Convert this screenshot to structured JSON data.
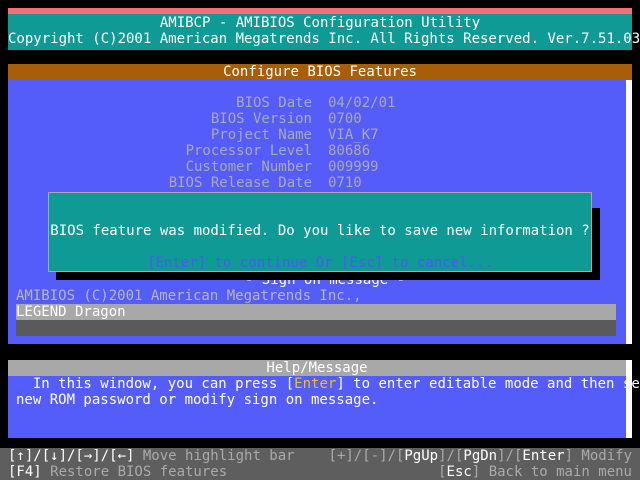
{
  "title_bar": {
    "line1": "AMIBCP - AMIBIOS Configuration Utility",
    "line2": "Copyright (C)2001 American Megatrends Inc. All Rights Reserved. Ver.7.51.03"
  },
  "config": {
    "header": "Configure BIOS Features",
    "fields": [
      {
        "label": "BIOS Date",
        "value": "04/02/01"
      },
      {
        "label": "BIOS Version",
        "value": "0700"
      },
      {
        "label": "Project Name",
        "value": "VIA_K7"
      },
      {
        "label": "Processor Level",
        "value": "80686"
      },
      {
        "label": "Customer Number",
        "value": "009999"
      },
      {
        "label": "BIOS Release Date",
        "value": "0710"
      }
    ],
    "sign_on_header": "- Sign on message -",
    "sign_on_line1": "AMIBIOS (C)2001 American Megatrends Inc.,",
    "sign_on_line2": "LEGEND Dragon",
    "sign_on_line3": ""
  },
  "dialog": {
    "message": "BIOS feature was modified. Do you like to save new information ?",
    "hint": "[Enter] to continue Or [Esc] to cancel..."
  },
  "help": {
    "header": "Help/Message",
    "line1_pre": "  In this window, you can press [",
    "line1_key": "Enter",
    "line1_post": "] to enter editable mode and then set",
    "line2": "new ROM password or modify sign on message."
  },
  "bottom_bar": {
    "left_row1_keys": "[↑]/[↓]/[→]/[←]",
    "left_row1_text": " Move highlight bar",
    "left_row2_key": "[F4]",
    "left_row2_text": " Restore BIOS features",
    "right_row1_p1": "[+]/[-]/[",
    "right_row1_k1": "PgUp",
    "right_row1_p2": "]/[",
    "right_row1_k2": "PgDn",
    "right_row1_p3": "]/[",
    "right_row1_k3": "Enter",
    "right_row1_p4": "] Modify",
    "right_row2_p1": "[",
    "right_row2_k1": "Esc",
    "right_row2_p2": "] Back to main menu"
  },
  "colors": {
    "title_bg": "#0f9a96",
    "panel_bg": "#545cfa",
    "config_header_bg": "#a85d09",
    "accent_red": "#f06e74",
    "key_highlight": "#f4c300"
  }
}
